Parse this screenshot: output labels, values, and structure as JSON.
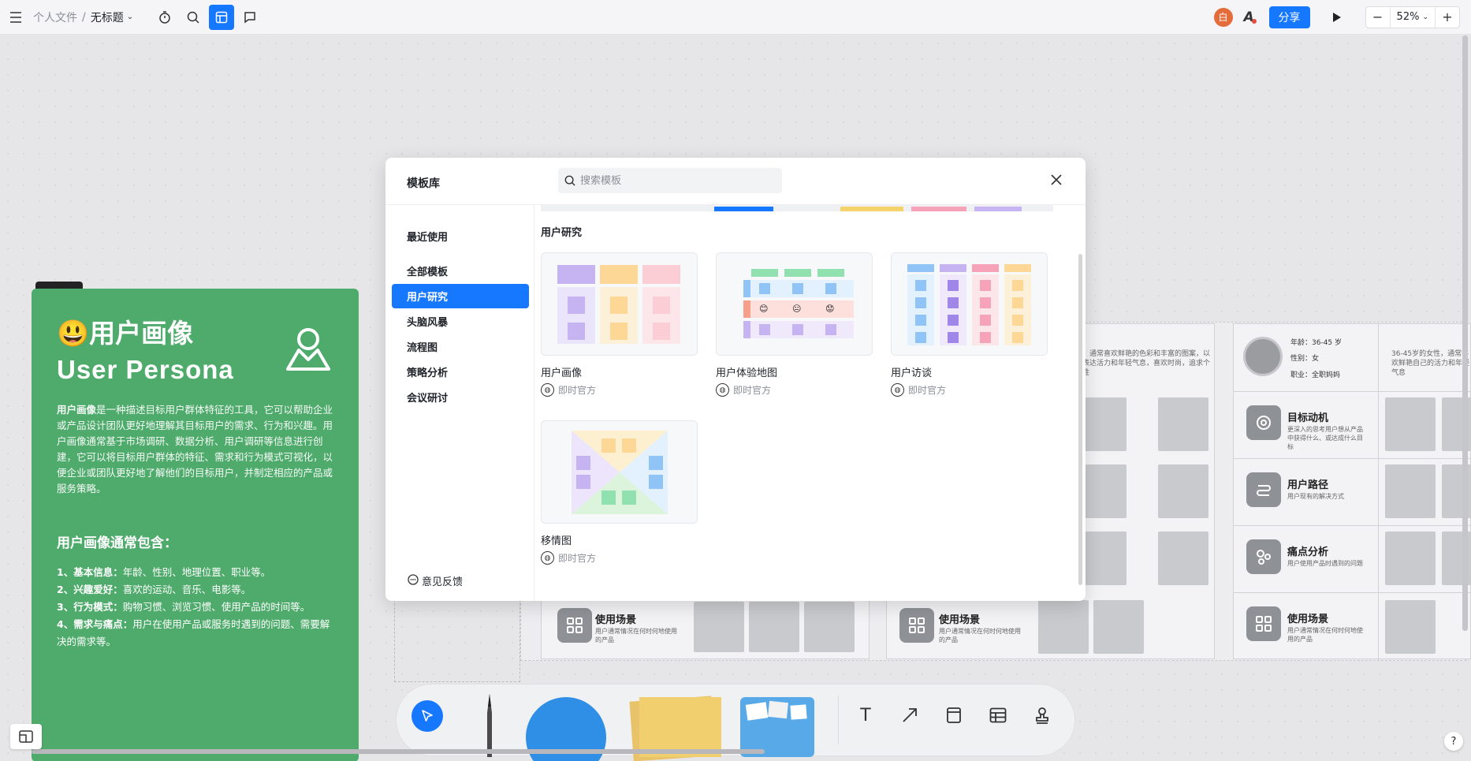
{
  "topbar": {
    "folder": "个人文件",
    "separator": "/",
    "doc_title": "无标题",
    "avatar_initial": "白",
    "share_label": "分享",
    "zoom_value": "52%",
    "zoom_out": "−",
    "zoom_in": "+"
  },
  "persona": {
    "title_cn": "😃用户画像",
    "title_en": "User Persona",
    "desc_bold": "用户画像",
    "desc_rest": "是一种描述目标用户群体特征的工具，它可以帮助企业或产品设计团队更好地理解其目标用户的需求、行为和兴趣。用户画像通常基于市场调研、数据分析、用户调研等信息进行创建，它可以将目标用户群体的特征、需求和行为模式可视化，以便企业或团队更好地了解他们的目标用户，并制定相应的产品或服务策略。",
    "subtitle": "用户画像通常包含：",
    "items": [
      {
        "bold": "1、基本信息：",
        "rest": "年龄、性别、地理位置、职业等。"
      },
      {
        "bold": "2、兴趣爱好：",
        "rest": "喜欢的运动、音乐、电影等。"
      },
      {
        "bold": "3、行为模式：",
        "rest": "购物习惯、浏览习惯、使用产品的时间等。"
      },
      {
        "bold": "4、需求与痛点：",
        "rest": "用户在使用产品或服务时遇到的问题、需要解决的需求等。"
      }
    ]
  },
  "boards": {
    "scene_label": "使用场景",
    "scene_sub": "用户通常情况在何时何地使用的产品",
    "goal_label": "目标动机",
    "goal_sub": "更深入的思考用户想从产品中获得什么、或达成什么目标",
    "path_label": "用户路径",
    "path_sub": "用户现有的解决方式",
    "pain_label": "痛点分析",
    "pain_sub": "用户使用产品时遇到的问题",
    "profile_age": "年龄：36-45 岁",
    "profile_gender": "性别：女",
    "profile_job": "职业：全职妈妈",
    "quote_a": "，通常喜欢鲜艳的色彩和丰富的图案，以表达活力和年轻气息，喜欢时尚，追求个性",
    "quote_b": "36-45岁的女性，通常喜欢鲜艳自己的活力和年轻气息"
  },
  "modal": {
    "title": "模板库",
    "search_placeholder": "搜索模板",
    "sidebar": [
      "最近使用",
      "全部模板",
      "用户研究",
      "头脑风暴",
      "流程图",
      "策略分析",
      "会议研讨"
    ],
    "active_index": 2,
    "feedback": "意见反馈",
    "section_title": "用户研究",
    "templates": [
      {
        "name": "用户画像",
        "author": "即时官方"
      },
      {
        "name": "用户体验地图",
        "author": "即时官方"
      },
      {
        "name": "用户访谈",
        "author": "即时官方"
      },
      {
        "name": "移情图",
        "author": "即时官方"
      }
    ]
  },
  "toolbar": {
    "text_tool": "T"
  },
  "colors": {
    "accent": "#1677ff",
    "persona_green": "#4fab6c"
  },
  "icons": [
    "menu-icon",
    "timer-icon",
    "search-icon",
    "template-icon",
    "comment-icon",
    "font-icon",
    "play-icon",
    "pointer-icon",
    "text-icon",
    "arrow-icon",
    "frame-icon",
    "table-icon",
    "stamp-icon",
    "minimap-icon",
    "help-icon",
    "close-icon"
  ]
}
